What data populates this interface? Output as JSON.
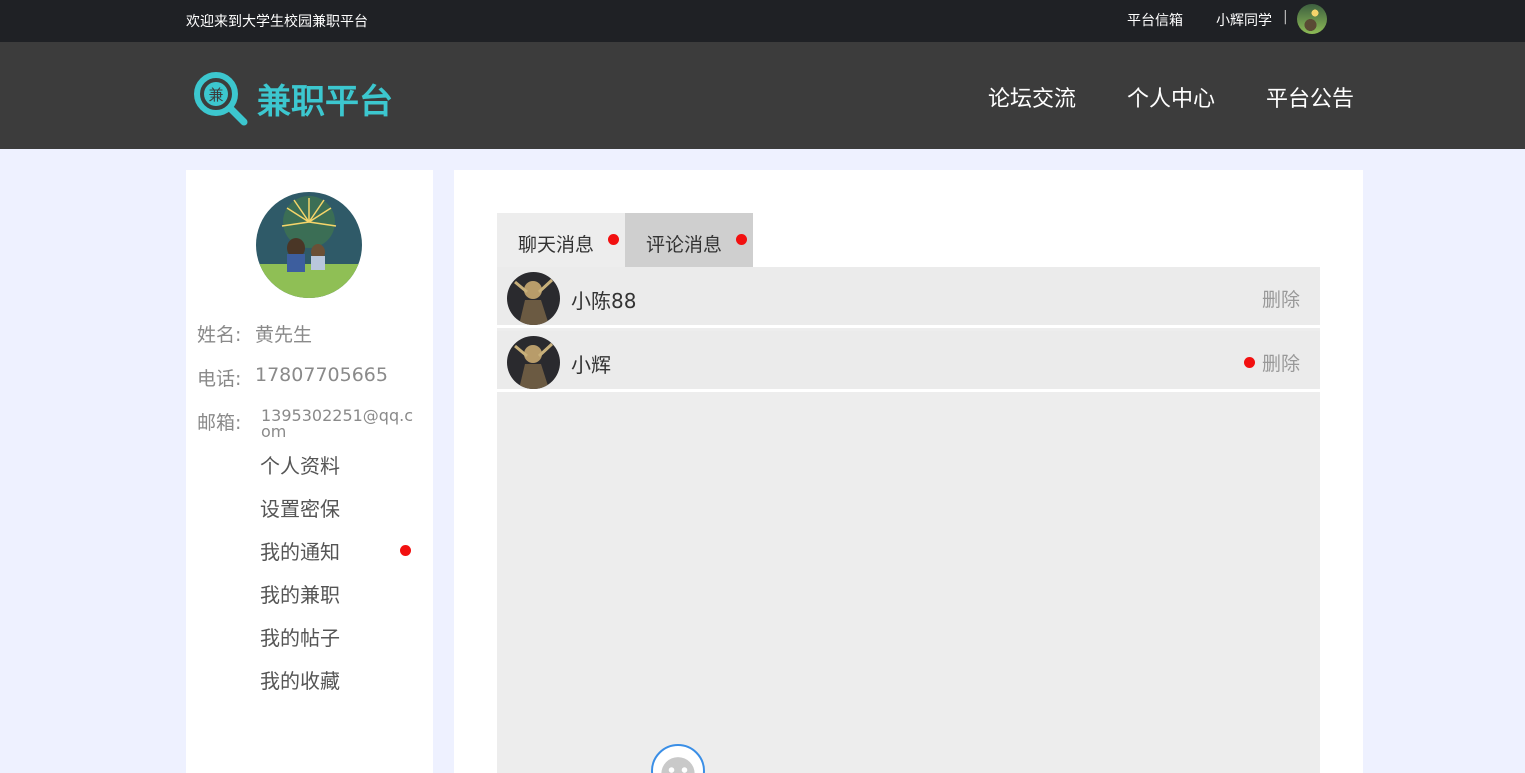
{
  "topbar": {
    "welcome": "欢迎来到大学生校园兼职平台",
    "mailbox": "平台信箱",
    "username": "小辉同学",
    "separator": "|"
  },
  "brand": {
    "logo_char": "兼",
    "name": "兼职平台",
    "color": "#3cc7cf"
  },
  "nav": {
    "items": [
      {
        "label": "论坛交流"
      },
      {
        "label": "个人中心"
      },
      {
        "label": "平台公告"
      }
    ]
  },
  "profile": {
    "name_label": "姓名:",
    "name": "黄先生",
    "phone_label": "电话:",
    "phone": "17807705665",
    "email_label": "邮箱:",
    "email": "1395302251@qq.com"
  },
  "sidebar_menu": [
    {
      "label": "个人资料"
    },
    {
      "label": "设置密保"
    },
    {
      "label": "我的通知"
    },
    {
      "label": "我的兼职"
    },
    {
      "label": "我的帖子"
    },
    {
      "label": "我的收藏"
    }
  ],
  "tabs": [
    {
      "label": "聊天消息"
    },
    {
      "label": "评论消息"
    }
  ],
  "messages": [
    {
      "name": "小陈88",
      "delete_label": "删除"
    },
    {
      "name": "小辉",
      "delete_label": "删除"
    }
  ],
  "colors": {
    "unread_dot": "#f21010",
    "topbar": "#1f2125",
    "header": "#3c3c3c",
    "background": "#eef1ff"
  }
}
